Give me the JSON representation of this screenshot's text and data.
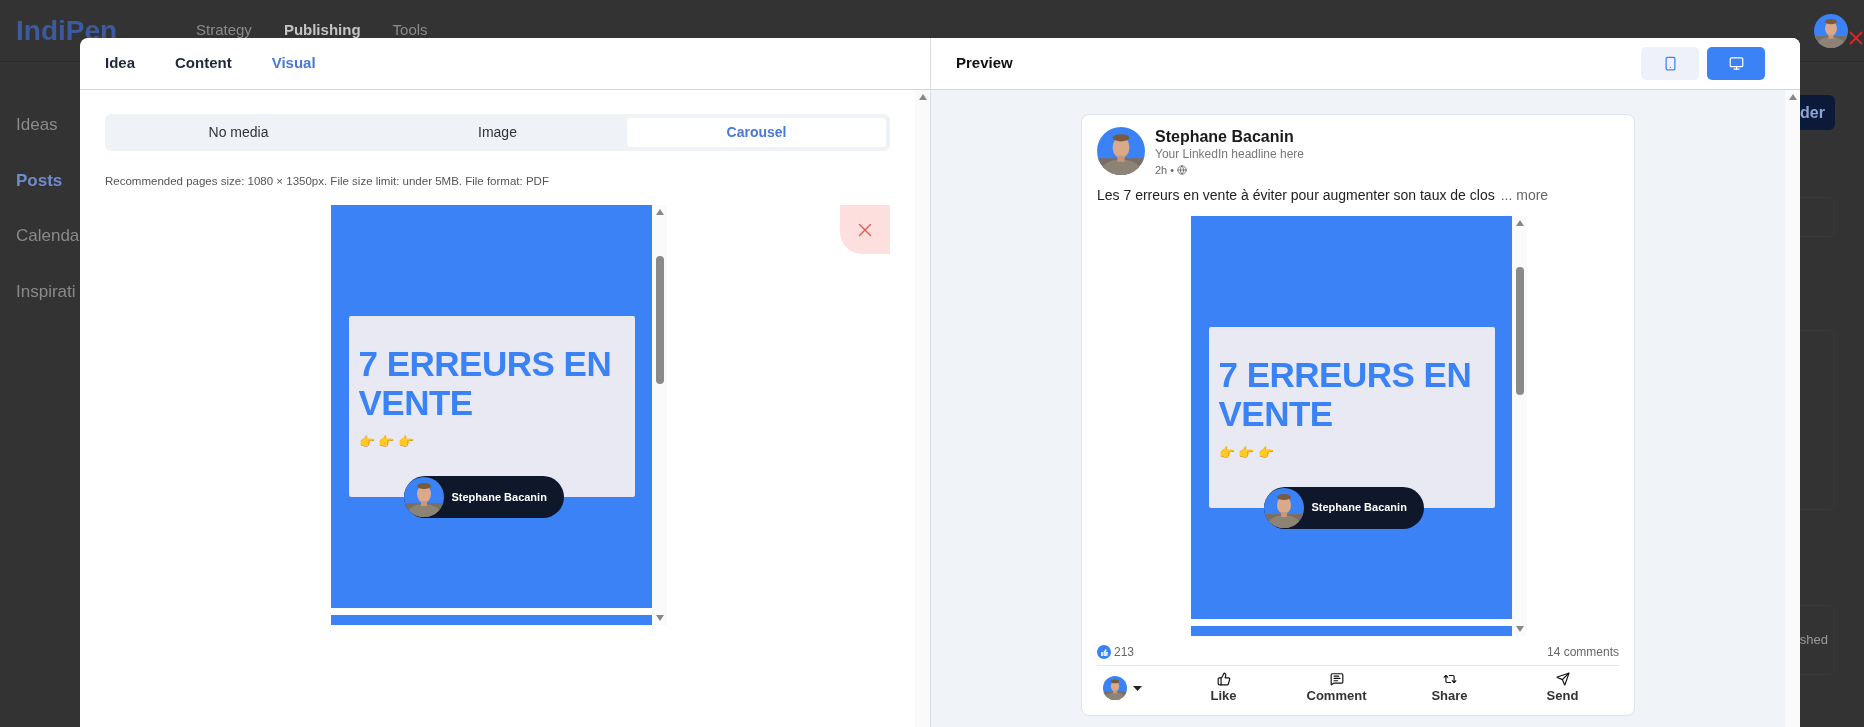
{
  "background_app": {
    "logo": "IndiPen",
    "nav": [
      {
        "label": "Strategy",
        "selected": false
      },
      {
        "label": "Publishing",
        "selected": true
      },
      {
        "label": "Tools",
        "selected": false
      }
    ],
    "sidebar": [
      {
        "label": "Ideas",
        "selected": false
      },
      {
        "label": "Posts",
        "selected": true
      },
      {
        "label": "Calenda",
        "selected": false
      },
      {
        "label": "Inspirati",
        "selected": false
      }
    ],
    "button_fragment": "der",
    "status_fragment": "shed"
  },
  "editor": {
    "tabs": [
      {
        "label": "Idea",
        "selected": false
      },
      {
        "label": "Content",
        "selected": false
      },
      {
        "label": "Visual",
        "selected": true
      }
    ],
    "media_options": [
      {
        "label": "No media",
        "selected": false
      },
      {
        "label": "Image",
        "selected": false
      },
      {
        "label": "Carousel",
        "selected": true
      }
    ],
    "hint": "Recommended pages size: 1080 × 1350px. File size limit: under 5MB. File format: PDF",
    "slide": {
      "title": "7 ERREURS EN VENTE",
      "emoji": "👉 👉 👉",
      "author": "Stephane Bacanin"
    }
  },
  "preview": {
    "title": "Preview",
    "devices": [
      {
        "kind": "mobile",
        "selected": false
      },
      {
        "kind": "desktop",
        "selected": true
      }
    ],
    "post": {
      "author": "Stephane Bacanin",
      "headline": "Your LinkedIn headline here",
      "time": "2h •",
      "text": "Les 7 erreurs en vente à éviter pour augmenter son taux de clos",
      "more": "... more",
      "slide": {
        "title": "7 ERREURS EN VENTE",
        "emoji": "👉 👉 👉",
        "author": "Stephane Bacanin"
      },
      "reactions": "213",
      "comments": "14 comments",
      "actions": [
        {
          "kind": "like",
          "label": "Like"
        },
        {
          "kind": "comment",
          "label": "Comment"
        },
        {
          "kind": "share",
          "label": "Share"
        },
        {
          "kind": "send",
          "label": "Send"
        }
      ]
    }
  }
}
